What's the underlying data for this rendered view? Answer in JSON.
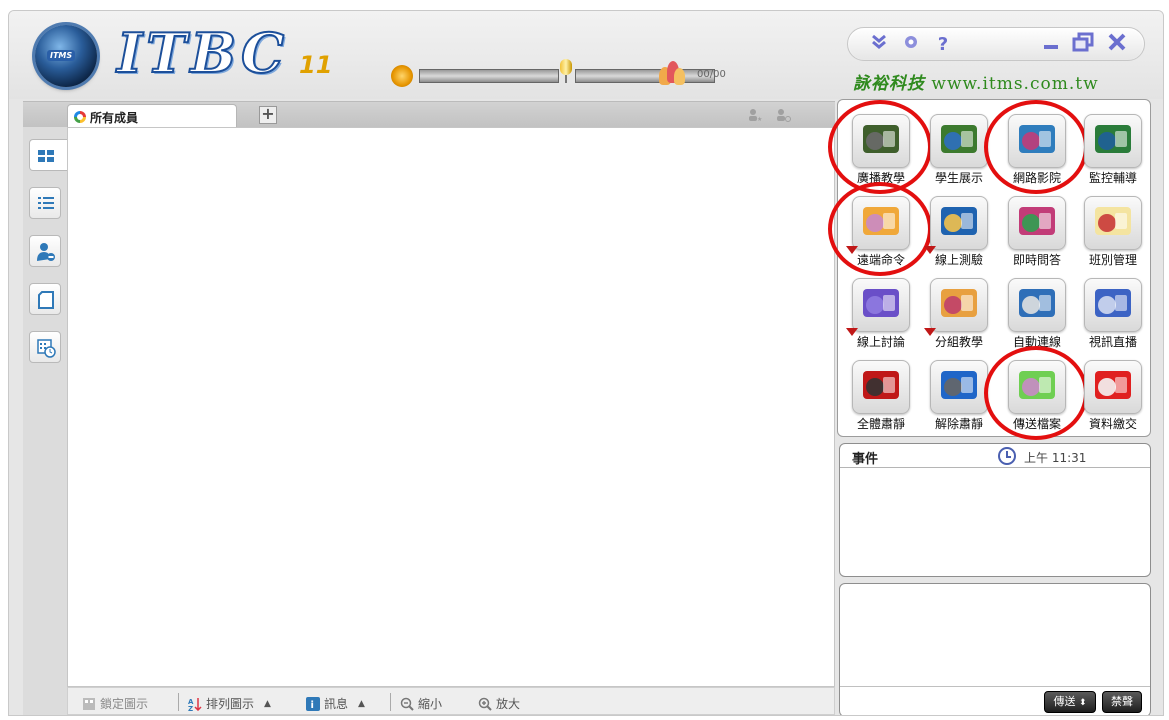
{
  "app": {
    "logo_badge": "ITMS",
    "logo_title": "ITBC",
    "logo_version": "11",
    "brand_cn": "詠裕科技",
    "brand_url": "www.itms.com.tw",
    "people_count": "00/00"
  },
  "tabs": [
    {
      "label": "所有成員"
    }
  ],
  "tools": [
    {
      "label": "廣播教學",
      "icon": "broadcast-teaching-icon",
      "circled": true
    },
    {
      "label": "學生展示",
      "icon": "student-demo-icon",
      "circled": false
    },
    {
      "label": "網路影院",
      "icon": "network-cinema-icon",
      "circled": true
    },
    {
      "label": "監控輔導",
      "icon": "monitor-icon",
      "circled": false
    },
    {
      "label": "遠端命令",
      "icon": "remote-command-icon",
      "circled": true,
      "dropdown": true
    },
    {
      "label": "線上測驗",
      "icon": "online-test-icon",
      "circled": false,
      "dropdown": true
    },
    {
      "label": "即時問答",
      "icon": "live-qa-icon",
      "circled": false
    },
    {
      "label": "班別管理",
      "icon": "class-management-icon",
      "circled": false
    },
    {
      "label": "線上討論",
      "icon": "online-discussion-icon",
      "circled": false,
      "dropdown": true
    },
    {
      "label": "分組教學",
      "icon": "group-teaching-icon",
      "circled": false,
      "dropdown": true
    },
    {
      "label": "自動連線",
      "icon": "auto-connect-icon",
      "circled": false
    },
    {
      "label": "視訊直播",
      "icon": "video-live-icon",
      "circled": false
    },
    {
      "label": "全體肅靜",
      "icon": "mute-all-icon",
      "circled": false
    },
    {
      "label": "解除肅靜",
      "icon": "unmute-icon",
      "circled": false
    },
    {
      "label": "傳送檔案",
      "icon": "send-file-icon",
      "circled": true
    },
    {
      "label": "資料繳交",
      "icon": "submit-data-icon",
      "circled": false
    }
  ],
  "events": {
    "title": "事件",
    "time": "上午 11:31"
  },
  "message": {
    "send_label": "傳送",
    "ban_label": "禁聲"
  },
  "statusbar": {
    "lock_icons": "鎖定圖示",
    "sort_icons": "排列圖示",
    "messages": "訊息",
    "zoom_out": "縮小",
    "zoom_in": "放大"
  },
  "colors": {
    "accent_red_circle": "#e30f0f",
    "brand_green": "#2f8a1e",
    "logo_blue": "#1c4f9a"
  }
}
